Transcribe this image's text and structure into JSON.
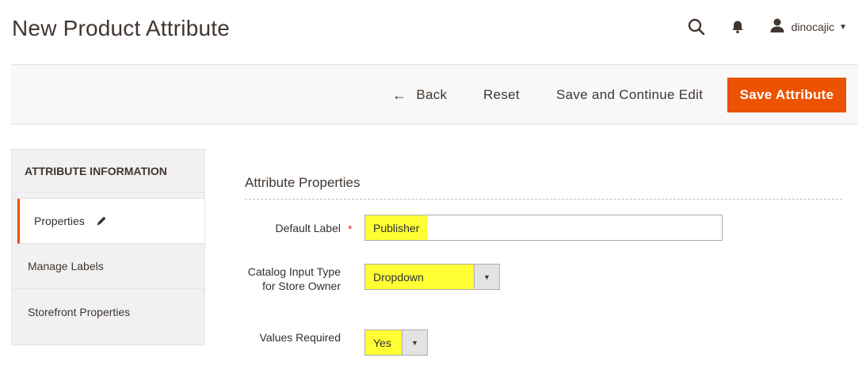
{
  "header": {
    "title": "New Product Attribute",
    "search_icon": "search-icon",
    "notifications_icon": "bell-icon",
    "user": {
      "icon": "user-icon",
      "name": "dinocajic",
      "caret": "▼"
    }
  },
  "action_bar": {
    "back_label": "Back",
    "back_arrow": "←",
    "reset_label": "Reset",
    "continue_label": "Save and Continue Edit",
    "save_label": "Save Attribute",
    "save_color": "#eb5202"
  },
  "sidebar": {
    "title": "ATTRIBUTE INFORMATION",
    "items": [
      {
        "label": "Properties",
        "active": true,
        "icon": "pencil-icon"
      },
      {
        "label": "Manage Labels",
        "active": false
      },
      {
        "label": "Storefront Properties",
        "active": false
      }
    ]
  },
  "main": {
    "section_title": "Attribute Properties",
    "fields": {
      "default_label": {
        "label": "Default Label",
        "required_mark": "*",
        "value": "Publisher"
      },
      "catalog_input": {
        "label": "Catalog Input Type for Store Owner",
        "value": "Dropdown",
        "arrow": "▼"
      },
      "values_required": {
        "label": "Values Required",
        "value": "Yes",
        "arrow": "▼"
      }
    }
  },
  "colors": {
    "accent": "#eb5202",
    "highlight": "#ffff33",
    "required": "#e22626"
  }
}
